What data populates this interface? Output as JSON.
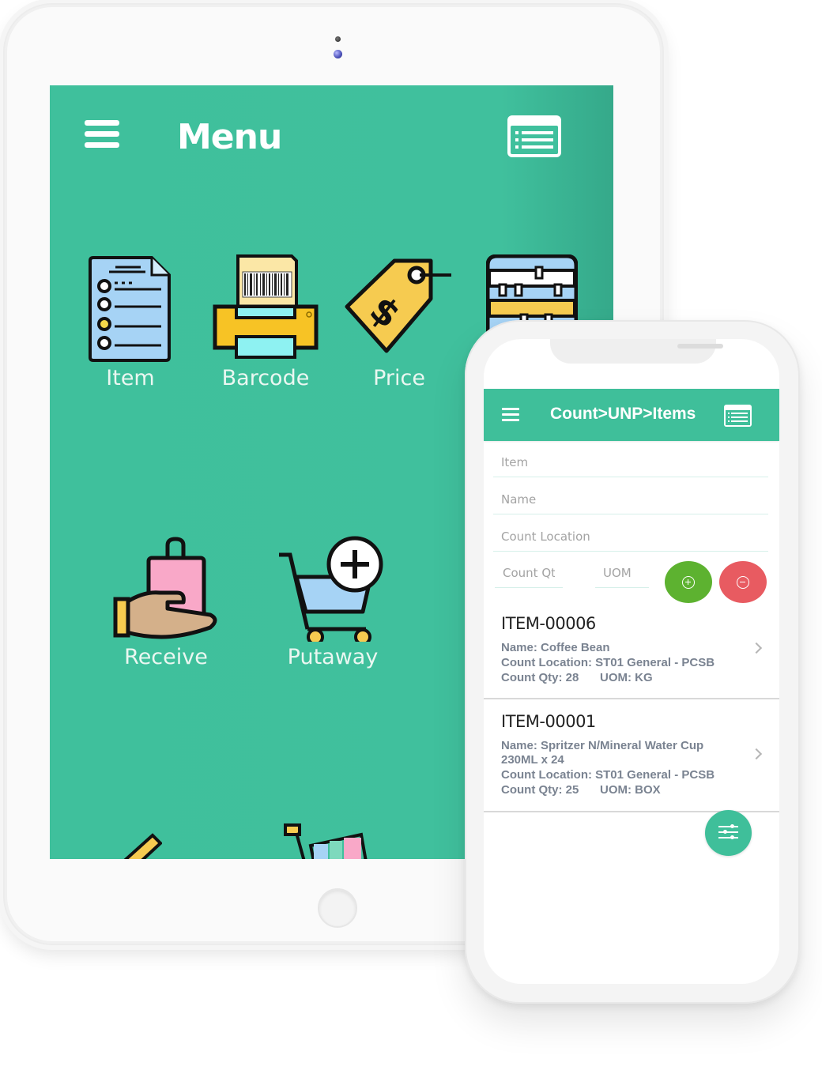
{
  "tablet": {
    "header": {
      "title": "Menu",
      "menu_icon": "hamburger-icon",
      "list_icon": "list-view-icon"
    },
    "tiles": [
      {
        "label": "Item",
        "icon": "document-list-icon"
      },
      {
        "label": "Barcode",
        "icon": "barcode-printer-icon"
      },
      {
        "label": "Price",
        "icon": "price-tag-icon"
      },
      {
        "label": "",
        "icon": "abacus-icon"
      },
      {
        "label": "Receive",
        "icon": "hand-bag-icon"
      },
      {
        "label": "Putaway",
        "icon": "cart-add-icon"
      }
    ],
    "colors": {
      "primary": "#40c09d"
    }
  },
  "phone": {
    "header": {
      "title": "Count>UNP>Items",
      "menu_icon": "hamburger-icon",
      "list_icon": "list-view-icon"
    },
    "form": {
      "item_placeholder": "Item",
      "name_placeholder": "Name",
      "location_placeholder": "Count Location",
      "qty_placeholder": "Count Qt",
      "uom_placeholder": "UOM",
      "add_icon": "plus-circle-icon",
      "remove_icon": "minus-circle-icon"
    },
    "items": [
      {
        "code": "ITEM-00006",
        "name": "Name: Coffee Bean",
        "name_cont": "",
        "location": "Count Location: ST01 General - PCSB",
        "qty": "Count Qty: 28",
        "uom": "UOM: KG"
      },
      {
        "code": "ITEM-00001",
        "name": "Name: Spritzer N/Mineral Water Cup",
        "name_cont": "230ML x 24",
        "location": "Count Location: ST01 General - PCSB",
        "qty": "Count Qty: 25",
        "uom": "UOM: BOX"
      }
    ],
    "fab_icon": "filter-sliders-icon",
    "colors": {
      "primary": "#3fbf9a",
      "add": "#5db230",
      "remove": "#e85b61"
    }
  }
}
